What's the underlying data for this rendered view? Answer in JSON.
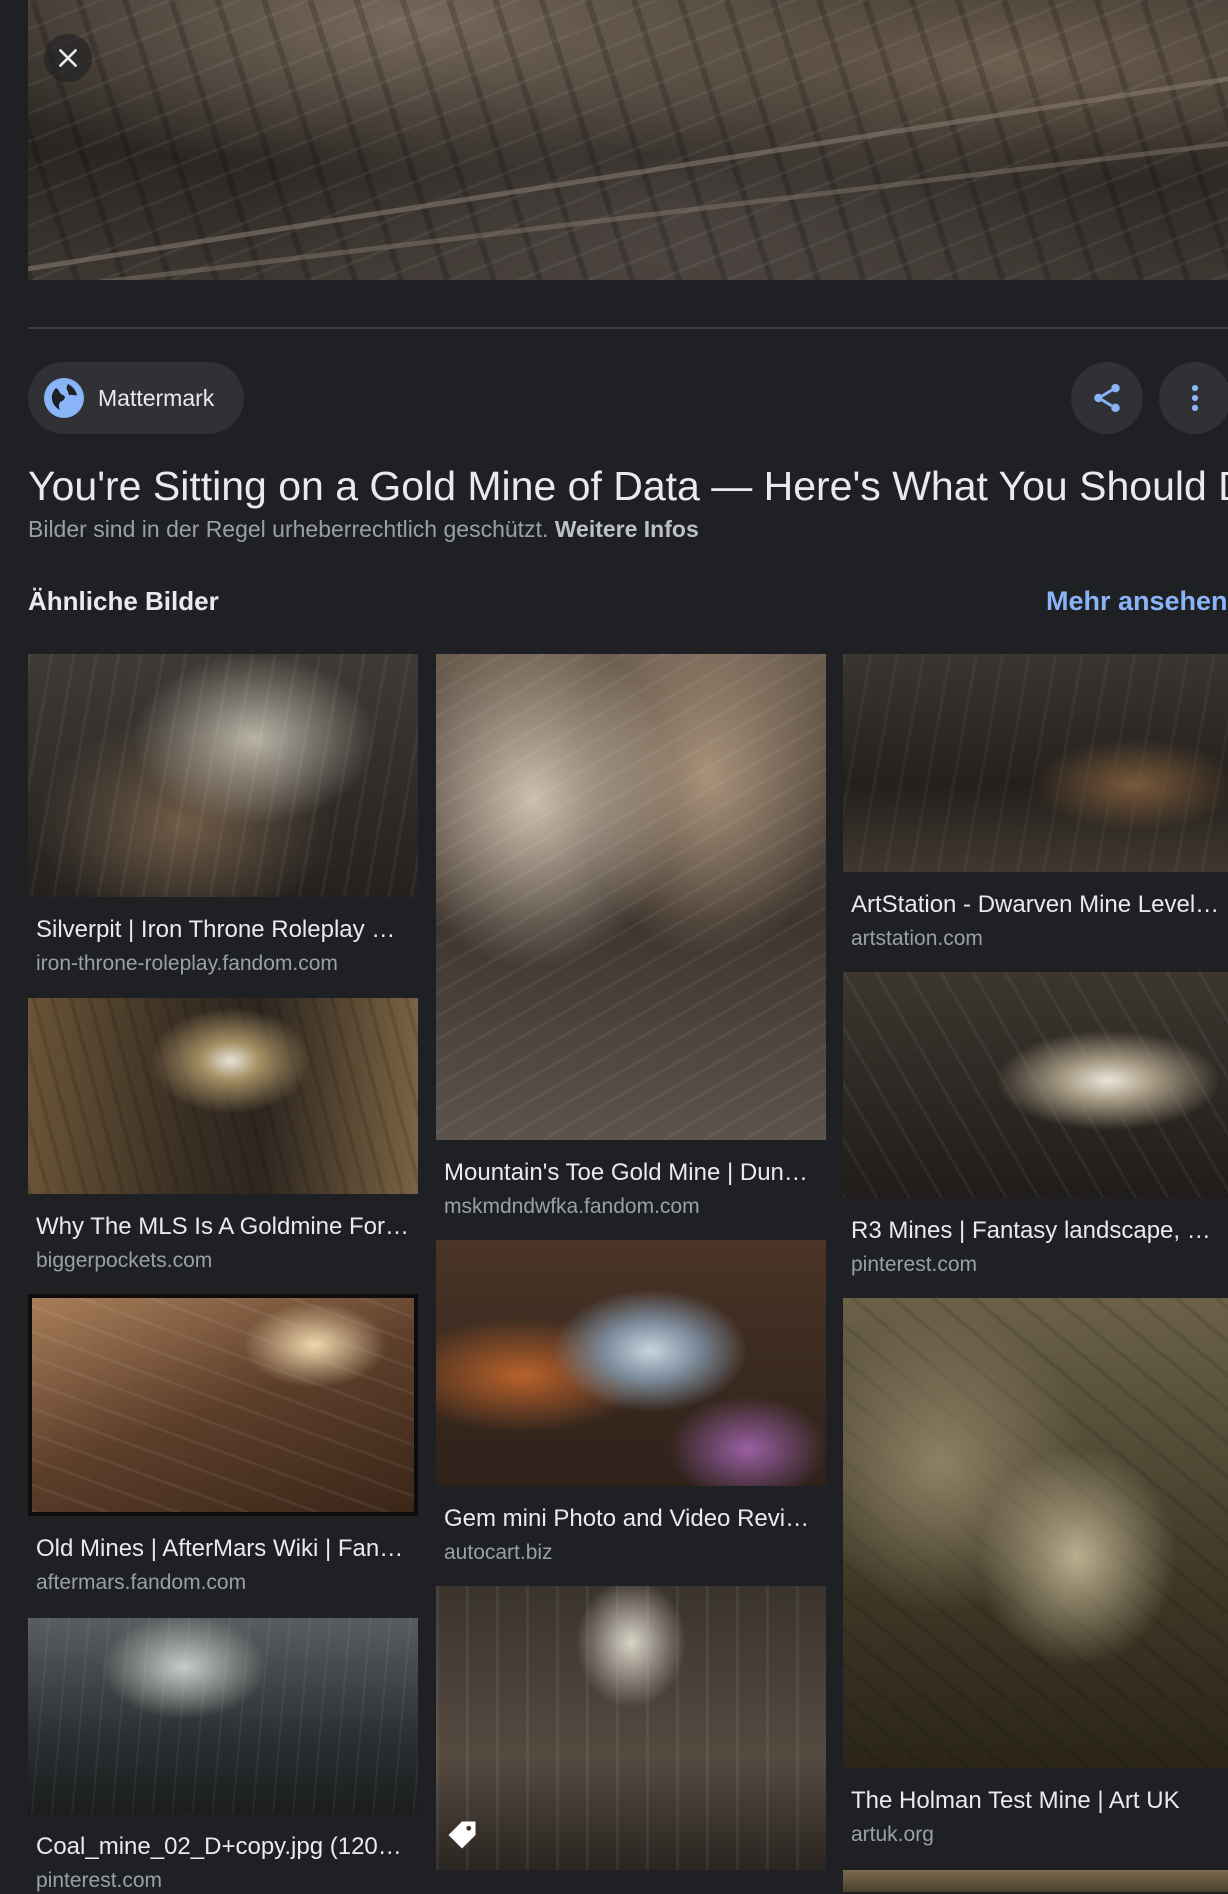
{
  "source": {
    "name": "Mattermark"
  },
  "title": "You're Sitting on a Gold Mine of Data — Here's What You Should D…",
  "copyright": {
    "text": "Bilder sind in der Regel urheberrechtlich geschützt.",
    "link": "Weitere Infos"
  },
  "similar": {
    "heading": "Ähnliche Bilder",
    "more": "Mehr ansehen",
    "items": [
      {
        "title": "Silverpit | Iron Throne Roleplay …",
        "domain": "iron-throne-roleplay.fandom.com"
      },
      {
        "title": "Why The MLS Is A Goldmine For …",
        "domain": "biggerpockets.com"
      },
      {
        "title": "Old Mines | AfterMars Wiki | Fan…",
        "domain": "aftermars.fandom.com"
      },
      {
        "title": "Coal_mine_02_D+copy.jpg (1200…",
        "domain": "pinterest.com"
      },
      {
        "title": "Mountain's Toe Gold Mine | Dun…",
        "domain": "mskmdndwfka.fandom.com"
      },
      {
        "title": "Gem mini Photo and Video Revi…",
        "domain": "autocart.biz"
      },
      {
        "title": "ArtStation - Dwarven Mine Level,…",
        "domain": "artstation.com"
      },
      {
        "title": "R3 Mines | Fantasy landscape, F…",
        "domain": "pinterest.com"
      },
      {
        "title": "The Holman Test Mine | Art UK",
        "domain": "artuk.org"
      }
    ]
  },
  "icons": {
    "close": "close-icon",
    "globe": "globe-icon",
    "share": "share-icon",
    "more": "more-vert-icon",
    "tag": "price-tag-icon"
  },
  "colors": {
    "background": "#1f2024",
    "accent": "#8ab4f8",
    "chip": "#303134"
  }
}
